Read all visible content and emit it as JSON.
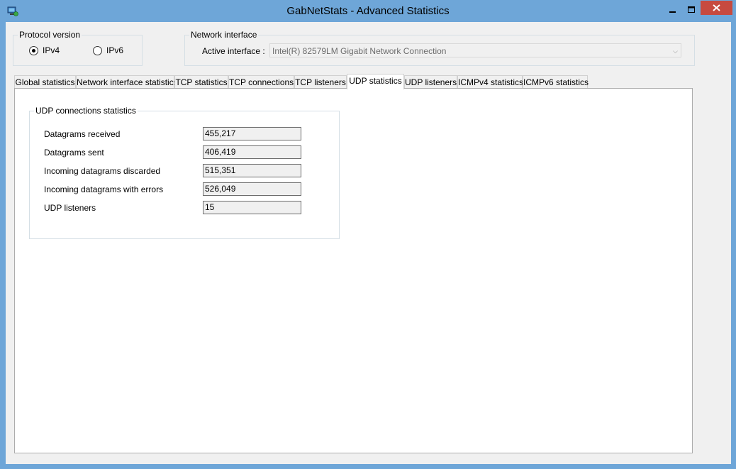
{
  "window": {
    "title": "GabNetStats - Advanced Statistics",
    "icons": [
      "app-icon",
      "minimize-icon",
      "maximize-icon",
      "close-icon"
    ]
  },
  "protocol": {
    "label": "Protocol version",
    "options": [
      {
        "label": "IPv4",
        "selected": true
      },
      {
        "label": "IPv6",
        "selected": false
      }
    ]
  },
  "network": {
    "label": "Network interface",
    "active_label": "Active interface :",
    "active_value": "Intel(R) 82579LM Gigabit Network Connection"
  },
  "tabs": [
    {
      "label": "Global statistics",
      "active": false
    },
    {
      "label": "Network interface statistics",
      "active": false
    },
    {
      "label": "TCP statistics",
      "active": false
    },
    {
      "label": "TCP connections",
      "active": false
    },
    {
      "label": "TCP listeners",
      "active": false
    },
    {
      "label": "UDP statistics",
      "active": true
    },
    {
      "label": "UDP listeners",
      "active": false
    },
    {
      "label": "ICMPv4 statistics",
      "active": false
    },
    {
      "label": "ICMPv6 statistics",
      "active": false
    }
  ],
  "udp": {
    "title": "UDP connections statistics",
    "rows": [
      {
        "label": "Datagrams received",
        "value": "455,217"
      },
      {
        "label": "Datagrams sent",
        "value": "406,419"
      },
      {
        "label": "Incoming datagrams discarded",
        "value": "515,351"
      },
      {
        "label": "Incoming datagrams with errors",
        "value": "526,049"
      },
      {
        "label": "UDP listeners",
        "value": "15"
      }
    ]
  },
  "colors": {
    "frame": "#6ea6d8",
    "client": "#f0f0f0",
    "close": "#c74a3f"
  }
}
